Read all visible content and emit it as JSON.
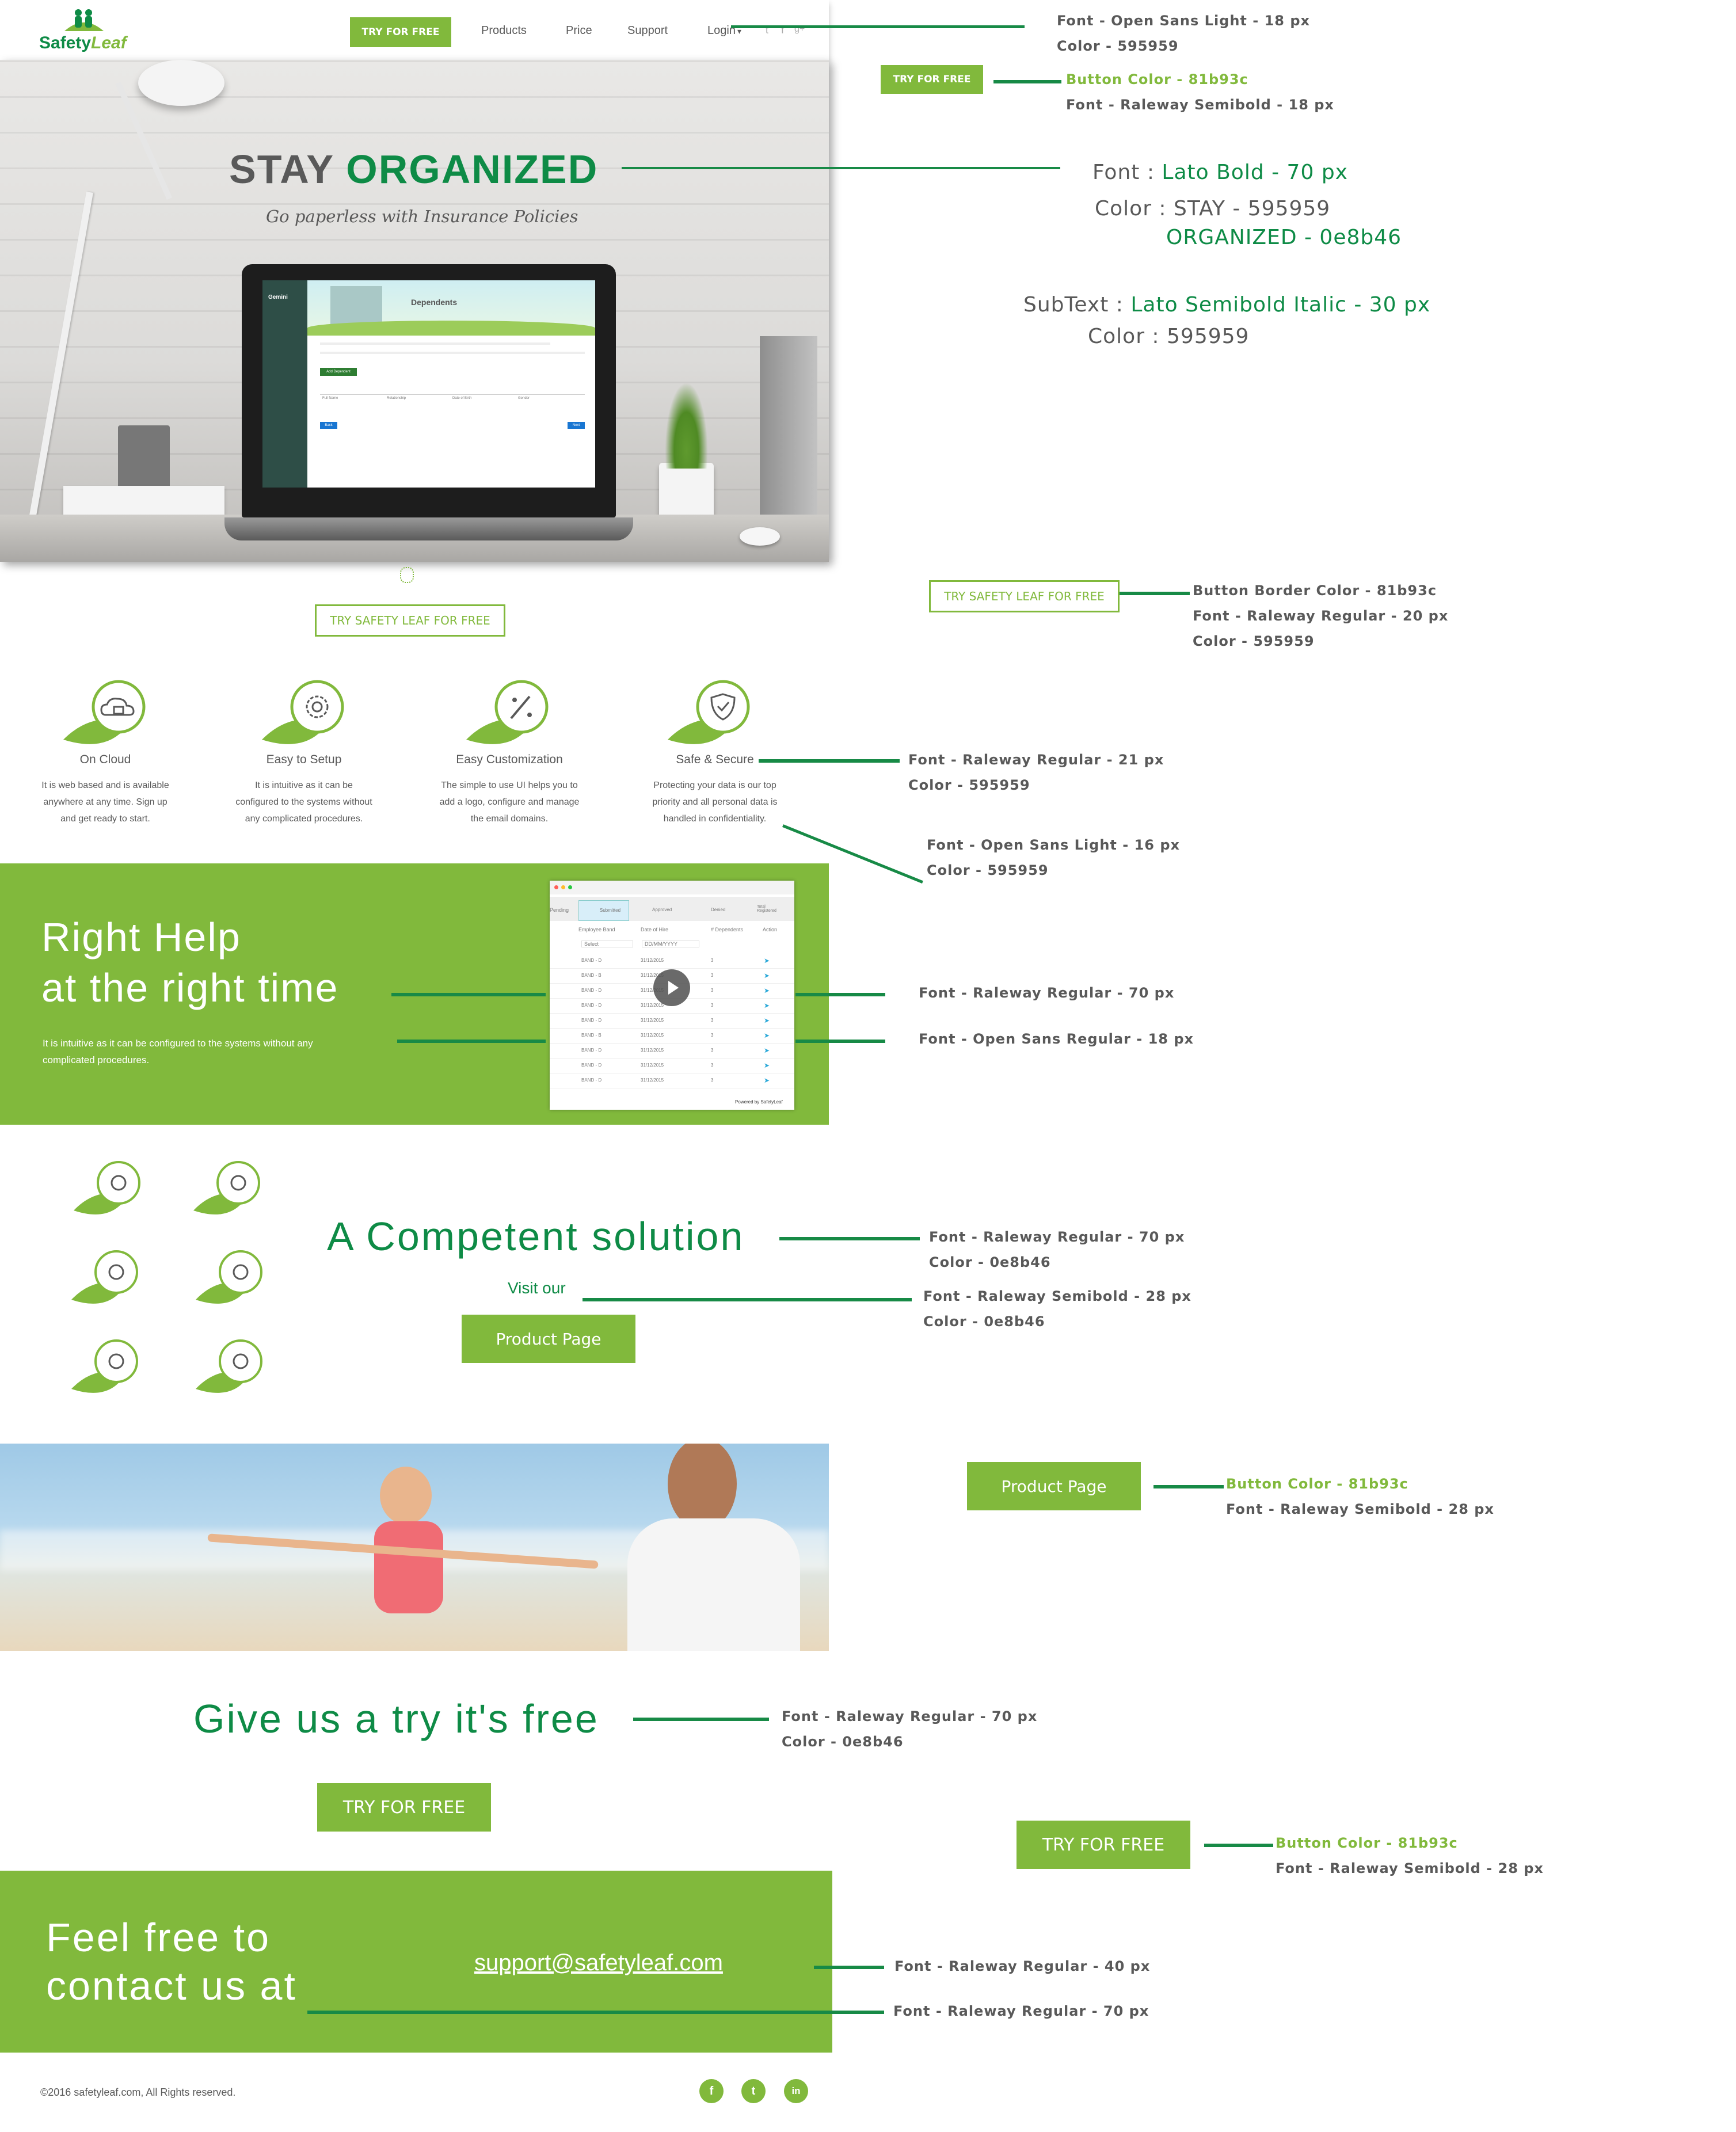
{
  "header": {
    "logo_text_a": "Safety",
    "logo_text_b": "Leaf",
    "try_button": "TRY FOR FREE",
    "nav": [
      "Products",
      "Price",
      "Support",
      "Login"
    ],
    "login_caret": "▾",
    "social_glyphs": [
      "t",
      "f",
      "g+"
    ]
  },
  "hero": {
    "title_a": "STAY",
    "title_b": "ORGANIZED",
    "subtitle": "Go paperless with Insurance Policies",
    "laptop": {
      "sidebar_title": "Gemini",
      "screen_heading": "Dependents",
      "add_button": "Add Dependent",
      "columns": [
        "Full Name",
        "Relationship",
        "Date of Birth",
        "Gender"
      ],
      "back": "Back",
      "next": "Next"
    },
    "cta": "TRY SAFETY LEAF FOR FREE"
  },
  "features": [
    {
      "icon": "cloud-lock-icon",
      "title": "On Cloud",
      "desc": [
        "It is web based and is available",
        "anywhere at any time. Sign up",
        "and get ready to start."
      ]
    },
    {
      "icon": "gear-icon",
      "title": "Easy to Setup",
      "desc": [
        "It is intuitive as it can be",
        "configured to the systems without",
        "any complicated procedures."
      ]
    },
    {
      "icon": "brush-icon",
      "title": "Easy Customization",
      "desc": [
        "The simple to use UI helps you to",
        "add a logo, configure and manage",
        "the email domains."
      ]
    },
    {
      "icon": "shield-check-icon",
      "title": "Safe & Secure",
      "desc": [
        "Protecting your data is our top",
        "priority and all personal data is",
        "handled in confidentiality."
      ]
    }
  ],
  "help": {
    "title_1": "Right Help",
    "title_2": "at the right time",
    "body_1": "It is intuitive as it can be configured to the systems without any",
    "body_2": "complicated procedures.",
    "video": {
      "tabs": [
        "Pending",
        "Submitted",
        "Approved",
        "Denied",
        "Total Registered"
      ],
      "columns": [
        "Employee Band",
        "Date of Hire",
        "# Dependents",
        "Action"
      ],
      "select_placeholder": "Select",
      "date_placeholder": "DD/MM/YYYY",
      "rows": [
        [
          "BAND - D",
          "31/12/2015",
          "3"
        ],
        [
          "BAND - B",
          "31/12/2015",
          "3"
        ],
        [
          "BAND - D",
          "31/12/2015",
          "3"
        ],
        [
          "BAND - D",
          "31/12/2015",
          "3"
        ],
        [
          "BAND - D",
          "31/12/2015",
          "3"
        ],
        [
          "BAND - B",
          "31/12/2015",
          "3"
        ],
        [
          "BAND - D",
          "31/12/2015",
          "3"
        ],
        [
          "BAND - D",
          "31/12/2015",
          "3"
        ],
        [
          "BAND - D",
          "31/12/2015",
          "3"
        ]
      ],
      "powered": "Powered by SafetyLeaf"
    }
  },
  "competent": {
    "title": "A Competent solution",
    "visit": "Visit our",
    "button": "Product Page",
    "icons": [
      "person-icon",
      "runner-icon",
      "gauge-icon",
      "tools-icon",
      "cloud-icon",
      "sliders-icon"
    ]
  },
  "tryfree": {
    "title": "Give us a try it's free",
    "button": "TRY FOR FREE"
  },
  "contact": {
    "line_1": "Feel free to",
    "line_2": "contact us at",
    "email": "support@safetyleaf.com"
  },
  "footer": {
    "copyright": "©2016 safetyleaf.com, All Rights reserved.",
    "social": [
      "f",
      "t",
      "in"
    ]
  },
  "annotations": {
    "nav_font": {
      "l1": "Font - Open Sans Light - 18 px",
      "l2": "Color - 595959"
    },
    "try_sample": "TRY FOR FREE",
    "try_color": "Button Color - 81b93c",
    "try_font": "Font - Raleway Semibold - 18 px",
    "hero_font_label": "Font : ",
    "hero_font_value": "Lato Bold - 70 px",
    "hero_color_1": "Color : STAY - 595959",
    "hero_color_2": "ORGANIZED - 0e8b46",
    "hero_sub_label": "SubText : ",
    "hero_sub_value": "Lato Semibold Italic - 30 px",
    "hero_sub_color_label": "Color : ",
    "hero_sub_color_value": "595959",
    "cta_sample": "TRY SAFETY LEAF FOR FREE",
    "cta_border": "Button Border Color - 81b93c",
    "cta_font": "Font - Raleway Regular - 20 px",
    "cta_color": "Color - 595959",
    "feat_title_font": "Font - Raleway Regular - 21 px",
    "feat_title_color": "Color - 595959",
    "feat_desc_font": "Font - Open Sans Light - 16 px",
    "feat_desc_color": "Color - 595959",
    "help_title_font": "Font - Raleway Regular - 70 px",
    "help_body_font": "Font - Open Sans  Regular - 18 px",
    "comp_font": "Font - Raleway Regular - 70 px",
    "comp_color": "Color - 0e8b46",
    "visit_font": "Font - Raleway Semibold - 28 px",
    "visit_color": "Color - 0e8b46",
    "pp_sample": "Product Page",
    "pp_color": "Button Color - 81b93c",
    "pp_font": "Font - Raleway Semibold - 28 px",
    "give_font": "Font - Raleway Regular - 70 px",
    "give_color": "Color - 0e8b46",
    "try2_sample": "TRY FOR FREE",
    "try2_color": "Button Color - 81b93c",
    "try2_font": "Font - Raleway Semibold - 28 px",
    "email_font": "Font - Raleway Regular - 40 px",
    "contact_font": "Font - Raleway Regular - 70 px"
  },
  "colors": {
    "accent": "#81b93c",
    "dark_green": "#0e8b46",
    "text": "#595959",
    "line": "#178a46"
  }
}
